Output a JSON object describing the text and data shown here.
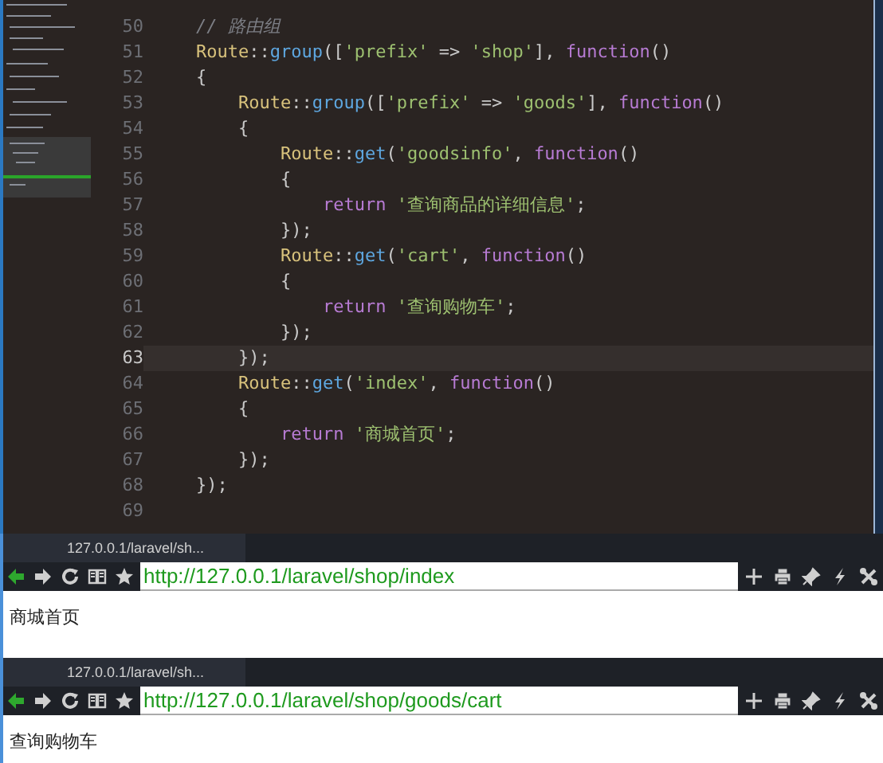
{
  "editor": {
    "lines": [
      {
        "number": "50",
        "current": false,
        "tokens": [
          {
            "kind": "comment",
            "text": "// 路由组"
          }
        ]
      },
      {
        "number": "51",
        "current": false,
        "tokens": [
          {
            "kind": "class",
            "text": "Route"
          },
          {
            "kind": "punct",
            "text": "::"
          },
          {
            "kind": "method",
            "text": "group"
          },
          {
            "kind": "punct",
            "text": "(["
          },
          {
            "kind": "string",
            "text": "'prefix'"
          },
          {
            "kind": "punct",
            "text": " => "
          },
          {
            "kind": "string",
            "text": "'shop'"
          },
          {
            "kind": "punct",
            "text": "], "
          },
          {
            "kind": "keyword",
            "text": "function"
          },
          {
            "kind": "punct",
            "text": "()"
          }
        ]
      },
      {
        "number": "52",
        "current": false,
        "tokens": [
          {
            "kind": "punct",
            "text": "{"
          }
        ]
      },
      {
        "number": "53",
        "current": false,
        "tokens": [
          {
            "kind": "class",
            "text": "    Route"
          },
          {
            "kind": "punct",
            "text": "::"
          },
          {
            "kind": "method",
            "text": "group"
          },
          {
            "kind": "punct",
            "text": "(["
          },
          {
            "kind": "string",
            "text": "'prefix'"
          },
          {
            "kind": "punct",
            "text": " => "
          },
          {
            "kind": "string",
            "text": "'goods'"
          },
          {
            "kind": "punct",
            "text": "], "
          },
          {
            "kind": "keyword",
            "text": "function"
          },
          {
            "kind": "punct",
            "text": "()"
          }
        ]
      },
      {
        "number": "54",
        "current": false,
        "tokens": [
          {
            "kind": "punct",
            "text": "    {"
          }
        ]
      },
      {
        "number": "55",
        "current": false,
        "tokens": [
          {
            "kind": "class",
            "text": "        Route"
          },
          {
            "kind": "punct",
            "text": "::"
          },
          {
            "kind": "method",
            "text": "get"
          },
          {
            "kind": "punct",
            "text": "("
          },
          {
            "kind": "string",
            "text": "'goodsinfo'"
          },
          {
            "kind": "punct",
            "text": ", "
          },
          {
            "kind": "keyword",
            "text": "function"
          },
          {
            "kind": "punct",
            "text": "()"
          }
        ]
      },
      {
        "number": "56",
        "current": false,
        "tokens": [
          {
            "kind": "punct",
            "text": "        {"
          }
        ]
      },
      {
        "number": "57",
        "current": false,
        "tokens": [
          {
            "kind": "keyword",
            "text": "            return "
          },
          {
            "kind": "string",
            "text": "'查询商品的详细信息'"
          },
          {
            "kind": "punct",
            "text": ";"
          }
        ]
      },
      {
        "number": "58",
        "current": false,
        "tokens": [
          {
            "kind": "punct",
            "text": "        });"
          }
        ]
      },
      {
        "number": "59",
        "current": false,
        "tokens": [
          {
            "kind": "class",
            "text": "        Route"
          },
          {
            "kind": "punct",
            "text": "::"
          },
          {
            "kind": "method",
            "text": "get"
          },
          {
            "kind": "punct",
            "text": "("
          },
          {
            "kind": "string",
            "text": "'cart'"
          },
          {
            "kind": "punct",
            "text": ", "
          },
          {
            "kind": "keyword",
            "text": "function"
          },
          {
            "kind": "punct",
            "text": "()"
          }
        ]
      },
      {
        "number": "60",
        "current": false,
        "tokens": [
          {
            "kind": "punct",
            "text": "        {"
          }
        ]
      },
      {
        "number": "61",
        "current": false,
        "tokens": [
          {
            "kind": "keyword",
            "text": "            return "
          },
          {
            "kind": "string",
            "text": "'查询购物车'"
          },
          {
            "kind": "punct",
            "text": ";"
          }
        ]
      },
      {
        "number": "62",
        "current": false,
        "tokens": [
          {
            "kind": "punct",
            "text": "        });"
          }
        ]
      },
      {
        "number": "63",
        "current": true,
        "tokens": [
          {
            "kind": "punct",
            "text": "    });"
          }
        ]
      },
      {
        "number": "64",
        "current": false,
        "tokens": [
          {
            "kind": "class",
            "text": "    Route"
          },
          {
            "kind": "punct",
            "text": "::"
          },
          {
            "kind": "method",
            "text": "get"
          },
          {
            "kind": "punct",
            "text": "("
          },
          {
            "kind": "string",
            "text": "'index'"
          },
          {
            "kind": "punct",
            "text": ", "
          },
          {
            "kind": "keyword",
            "text": "function"
          },
          {
            "kind": "punct",
            "text": "()"
          }
        ]
      },
      {
        "number": "65",
        "current": false,
        "tokens": [
          {
            "kind": "punct",
            "text": "    {"
          }
        ]
      },
      {
        "number": "66",
        "current": false,
        "tokens": [
          {
            "kind": "keyword",
            "text": "        return "
          },
          {
            "kind": "string",
            "text": "'商城首页'"
          },
          {
            "kind": "punct",
            "text": ";"
          }
        ]
      },
      {
        "number": "67",
        "current": false,
        "tokens": [
          {
            "kind": "punct",
            "text": "    });"
          }
        ]
      },
      {
        "number": "68",
        "current": false,
        "tokens": [
          {
            "kind": "punct",
            "text": "});"
          }
        ]
      },
      {
        "number": "69",
        "current": false
      }
    ]
  },
  "browsers": [
    {
      "tab": "127.0.0.1/laravel/sh...",
      "url": "http://127.0.0.1/laravel/shop/index",
      "content": "商城首页"
    },
    {
      "tab": "127.0.0.1/laravel/sh...",
      "url": "http://127.0.0.1/laravel/shop/goods/cart",
      "content": "查询购物车"
    }
  ]
}
